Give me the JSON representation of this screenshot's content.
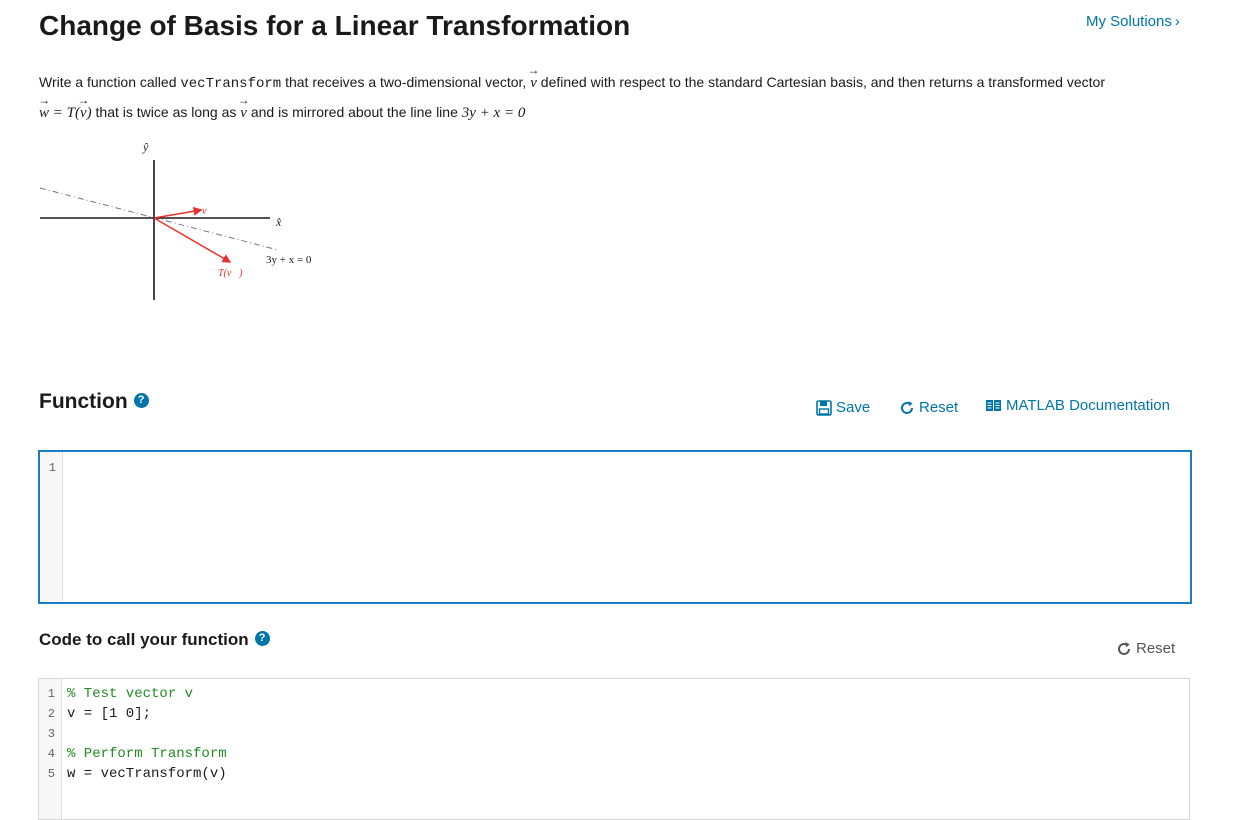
{
  "page": {
    "title": "Change of Basis for a Linear Transformation",
    "my_solutions": "My Solutions"
  },
  "description": {
    "line1_a": "Write a function called ",
    "line1_code": "vecTransform",
    "line1_b": " that receives a two-dimensional vector, ",
    "line1_v": "v",
    "line1_c": " defined with respect to the standard Cartesian basis, and then returns a transformed vector",
    "line2_w": "w",
    "line2_eq": " = T(",
    "line2_v": "v",
    "line2_close": ")",
    "line2_a": " that is twice as long as ",
    "line2_v2": "v",
    "line2_b": " and is mirrored about the line line ",
    "line2_math": "3y + x = 0"
  },
  "diagram": {
    "y_axis_label": "ŷ",
    "x_axis_label": "x̂",
    "v_label": "v⃗",
    "tv_label": "T(v⃗)",
    "line_label": "3y + x = 0",
    "vector_color": "#e8322b",
    "axis_color": "#1a1a1a",
    "line_color": "#777777"
  },
  "function_section": {
    "title": "Function",
    "save_label": "Save",
    "reset_label": "Reset",
    "doc_label": "MATLAB Documentation",
    "editor_lines": [
      "1"
    ]
  },
  "call_section": {
    "title": "Code to call your function",
    "reset_label": "Reset",
    "line_numbers": [
      "1",
      "2",
      "3",
      "4",
      "5"
    ],
    "lines": [
      {
        "text": "% Test vector v",
        "kind": "comment"
      },
      {
        "text": "v = [1 0];",
        "kind": "code"
      },
      {
        "text": "",
        "kind": "code"
      },
      {
        "text": "% Perform Transform",
        "kind": "comment"
      },
      {
        "text": "w = vecTransform(v)",
        "kind": "code"
      }
    ]
  },
  "colors": {
    "link": "#0076a8",
    "editor_border": "#1a7dc4",
    "comment": "#228b22"
  }
}
